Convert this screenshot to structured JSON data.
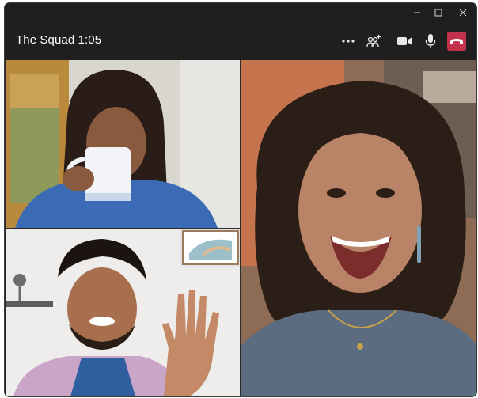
{
  "window": {
    "controls": [
      "minimize-icon",
      "maximize-icon",
      "close-icon"
    ]
  },
  "meeting": {
    "title": "The Squad 1:05"
  },
  "toolbar": {
    "items": [
      "more-options-icon",
      "participants-icon",
      "camera-icon",
      "microphone-icon",
      "hang-up-icon"
    ]
  },
  "colors": {
    "window_bg": "#1f1f1f",
    "hangup": "#c4314b",
    "text": "#ffffff"
  },
  "video_tiles": [
    {
      "position": "top-left"
    },
    {
      "position": "bottom-left"
    },
    {
      "position": "right"
    }
  ]
}
